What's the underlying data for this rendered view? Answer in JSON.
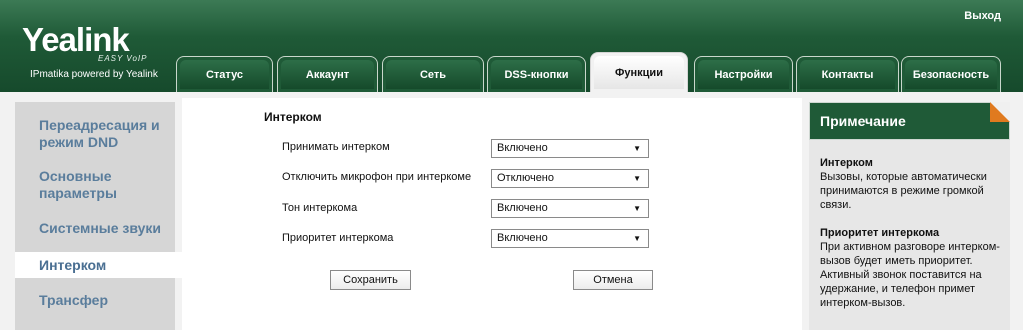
{
  "header": {
    "logo": "Yealink",
    "logo_sub": "EASY VoIP",
    "logo_tagline": "IPmatika powered by Yealink",
    "logout": "Выход"
  },
  "tabs": [
    "Статус",
    "Аккаунт",
    "Сеть",
    "DSS-кнопки",
    "Функции",
    "Настройки",
    "Контакты",
    "Безопасность"
  ],
  "active_tab": "Функции",
  "sidebar": {
    "items": [
      "Переадресация и режим DND",
      "Основные параметры",
      "Системные звуки",
      "Интерком",
      "Трансфер"
    ],
    "active": "Интерком"
  },
  "main": {
    "title": "Интерком",
    "rows": [
      {
        "label": "Принимать интерком",
        "value": "Включено"
      },
      {
        "label": "Отключить микрофон при интеркоме",
        "value": "Отключено"
      },
      {
        "label": "Тон интеркома",
        "value": "Включено"
      },
      {
        "label": "Приоритет интеркома",
        "value": "Включено"
      }
    ],
    "save": "Сохранить",
    "cancel": "Отмена"
  },
  "note": {
    "title": "Примечание",
    "item1_title": "Интерком",
    "item1_text": "Вызовы, которые автоматически принимаются в режиме громкой связи.",
    "item2_title": "Приоритет интеркома",
    "item2_text": "При активном разговоре интерком-вызов будет иметь приоритет. Активный звонок поставится на удержание, и телефон примет интерком-вызов."
  },
  "colors": {
    "brand_green": "#1f5a37",
    "sidebar_text": "#5a7d9c",
    "note_corner": "#e07a1f"
  }
}
